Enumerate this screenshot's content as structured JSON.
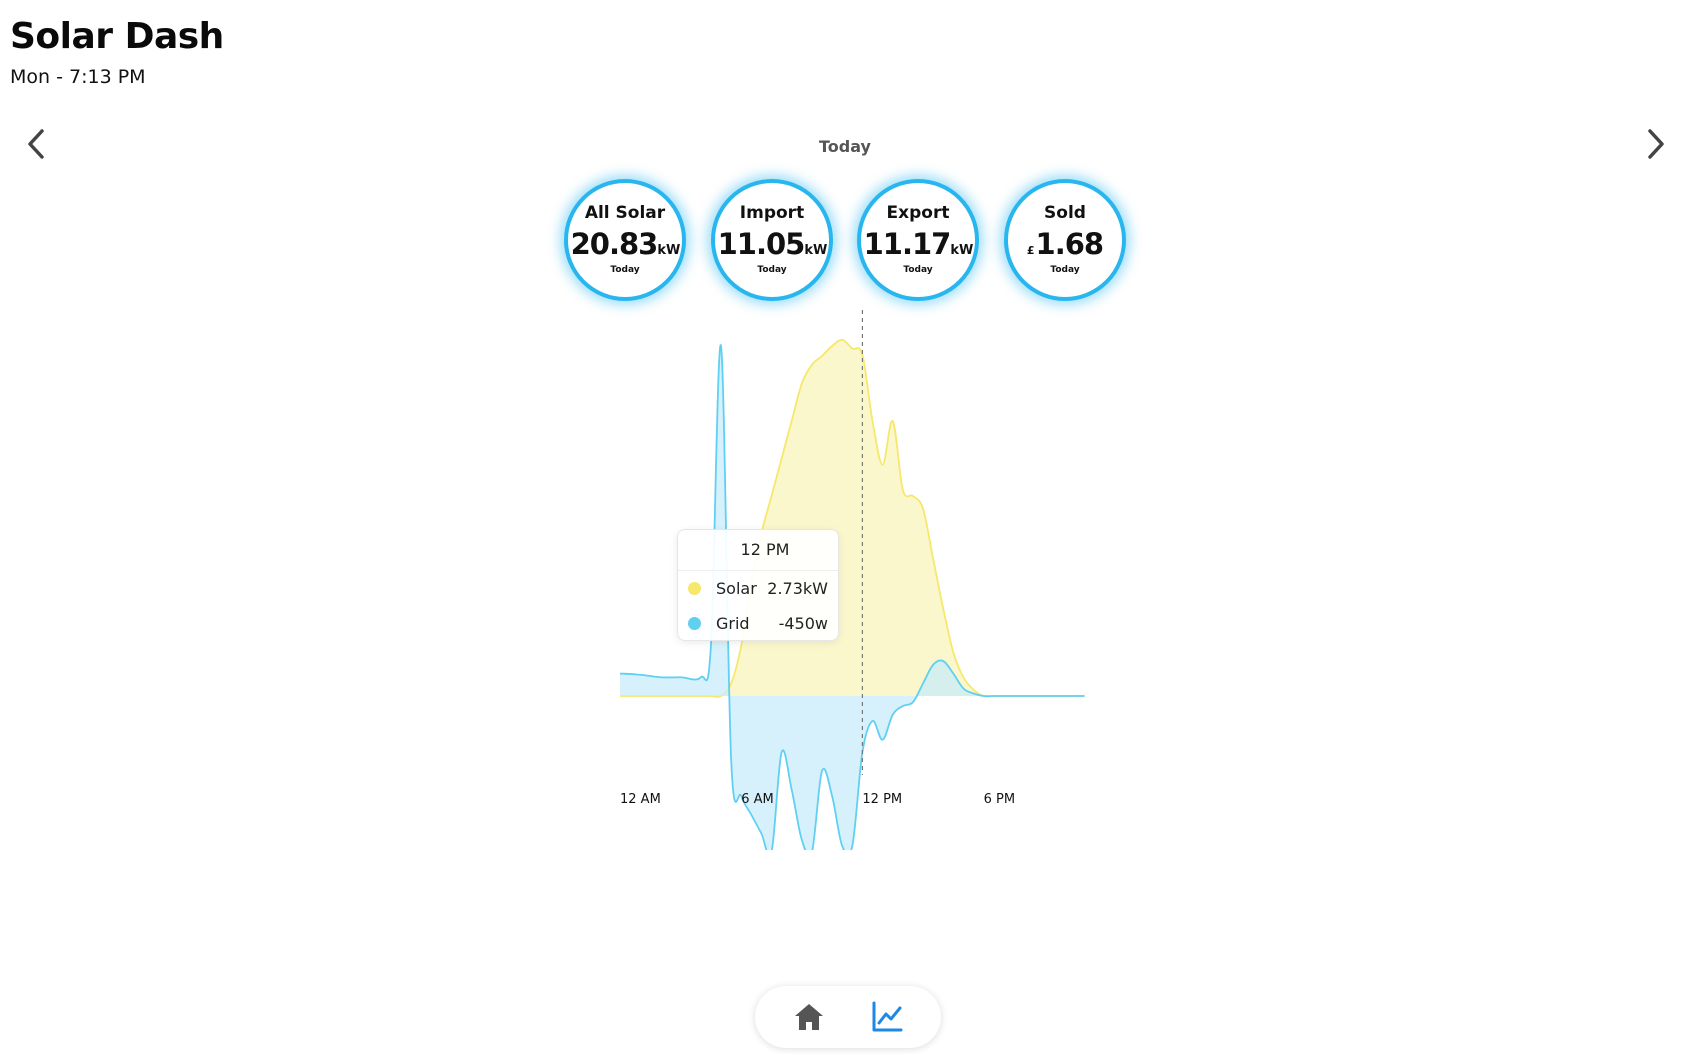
{
  "header": {
    "title": "Solar Dash",
    "subtitle": "Mon - 7:13 PM"
  },
  "nav": {
    "prev_icon": "chevron-left-icon",
    "next_icon": "chevron-right-icon",
    "period_label": "Today"
  },
  "stats": [
    {
      "title": "All Solar",
      "prefix": "",
      "value": "20.83",
      "unit": "kW",
      "period": "Today"
    },
    {
      "title": "Import",
      "prefix": "",
      "value": "11.05",
      "unit": "kW",
      "period": "Today"
    },
    {
      "title": "Export",
      "prefix": "",
      "value": "11.17",
      "unit": "kW",
      "period": "Today"
    },
    {
      "title": "Sold",
      "prefix": "£",
      "value": "1.68",
      "unit": "",
      "period": "Today"
    }
  ],
  "colors": {
    "accent": "#29b6ef",
    "solar": "#f5e86a",
    "solar_fill": "#fbf6c8",
    "grid": "#5fd0f2",
    "grid_fill": "#c8ecfa",
    "active_nav": "#1e88e5"
  },
  "tooltip": {
    "time": "12 PM",
    "rows": [
      {
        "label": "Solar",
        "value": "2.73kW"
      },
      {
        "label": "Grid",
        "value": "-450w"
      }
    ]
  },
  "chart_data": {
    "type": "area",
    "x_tick_labels": [
      "12 AM",
      "6 AM",
      "12 PM",
      "6 PM"
    ],
    "x_hours": [
      0,
      1,
      2,
      3,
      4,
      4.5,
      5,
      5.5,
      6,
      6.5,
      7,
      7.5,
      8,
      8.5,
      9,
      9.5,
      10,
      10.5,
      11,
      11.5,
      12,
      12.5,
      13,
      13.5,
      14,
      14.5,
      15,
      15.5,
      16,
      16.5,
      17,
      17.5,
      18,
      18.5,
      19,
      20,
      21,
      22,
      23
    ],
    "hover_hour": 12,
    "series": [
      {
        "name": "Solar",
        "values": [
          0,
          0,
          0,
          0,
          0,
          0,
          0,
          0.1,
          0.4,
          0.9,
          1.3,
          1.6,
          1.9,
          2.2,
          2.5,
          2.65,
          2.72,
          2.8,
          2.85,
          2.78,
          2.73,
          2.2,
          1.85,
          2.2,
          1.65,
          1.6,
          1.5,
          1.1,
          0.7,
          0.35,
          0.15,
          0.05,
          0,
          0,
          0,
          0,
          0,
          0,
          0
        ]
      },
      {
        "name": "Grid",
        "values": [
          0.18,
          0.17,
          0.15,
          0.15,
          0.15,
          0.4,
          2.8,
          -0.5,
          -0.8,
          -0.95,
          -1.1,
          -1.25,
          -0.45,
          -0.75,
          -1.15,
          -1.25,
          -0.6,
          -0.8,
          -1.2,
          -1.2,
          -0.45,
          -0.2,
          -0.35,
          -0.15,
          -0.08,
          -0.05,
          0.1,
          0.25,
          0.28,
          0.18,
          0.06,
          0.02,
          0,
          0,
          0,
          0,
          0,
          0,
          0
        ]
      }
    ]
  },
  "bottom_nav": [
    {
      "icon": "home-icon"
    },
    {
      "icon": "line-chart-icon"
    }
  ]
}
